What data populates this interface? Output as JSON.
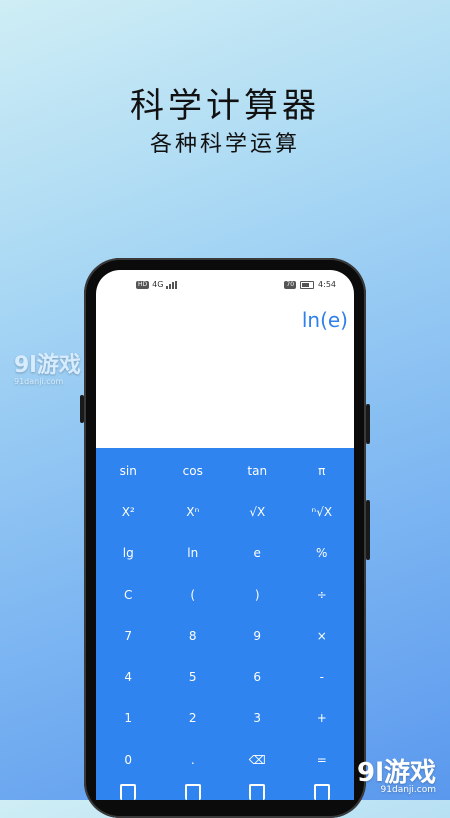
{
  "promo": {
    "title": "科学计算器",
    "subtitle": "各种科学运算"
  },
  "status_bar": {
    "left_badge": "HD",
    "network": "4G",
    "battery_label": "70",
    "time": "4:54"
  },
  "display": {
    "expression": "ln(e)"
  },
  "keys": [
    "sin",
    "cos",
    "tan",
    "π",
    "X²",
    "Xⁿ",
    "√X",
    "ⁿ√X",
    "lg",
    "ln",
    "e",
    "%",
    "C",
    "(",
    ")",
    "÷",
    "7",
    "8",
    "9",
    "×",
    "4",
    "5",
    "6",
    "-",
    "1",
    "2",
    "3",
    "+",
    "0",
    ".",
    "⌫",
    "="
  ],
  "watermark": {
    "left_logo": "9l游戏",
    "left_url": "91danji.com",
    "right_logo": "9l游戏",
    "right_url": "91danji.com"
  },
  "colors": {
    "accent": "#2f84ef",
    "display_text": "#2f80ea"
  }
}
